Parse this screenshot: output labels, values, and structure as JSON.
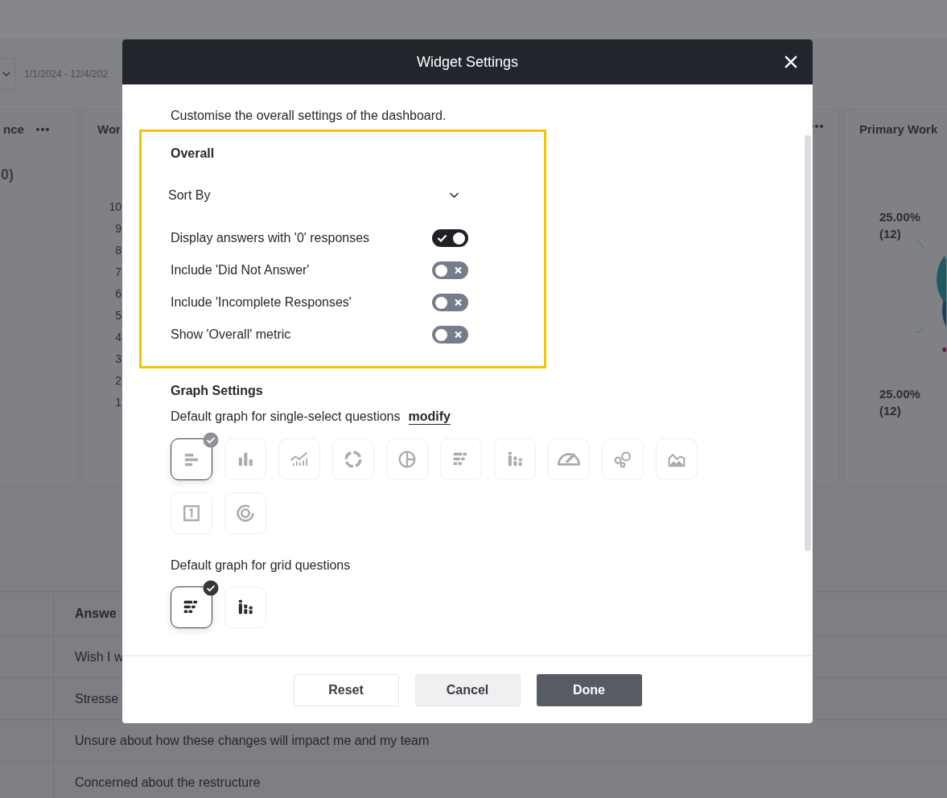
{
  "background": {
    "date_range": "1/1/2024 - 12/4/202",
    "cards": [
      {
        "kind": "value",
        "title": "nce",
        "value": "0)",
        "menu": true
      },
      {
        "kind": "axis",
        "title": "Wor",
        "axis_labels": [
          "10",
          "9",
          "8",
          "7",
          "6",
          "5",
          "4",
          "3",
          "2",
          "1"
        ]
      },
      {
        "kind": "hidden",
        "menu": true
      },
      {
        "kind": "pie",
        "title": "Primary Work",
        "slice_labels": [
          {
            "percent": "25.00%",
            "count": "(12)"
          },
          {
            "percent": "25.00%",
            "count": "(12)"
          }
        ]
      }
    ],
    "table": {
      "header": "Answe",
      "rows": [
        "Wish I w",
        "Stresse",
        "Unsure about how these changes will impact me and my team",
        "Concerned about the restructure"
      ]
    }
  },
  "dialog": {
    "title": "Widget Settings",
    "intro": "Customise the overall settings of the dashboard.",
    "overall": {
      "highlighted": true,
      "heading": "Overall",
      "sort_by": {
        "label": "Sort By"
      },
      "toggles": [
        {
          "label": "Display answers with '0' responses",
          "on": true
        },
        {
          "label": "Include 'Did Not Answer'",
          "on": false
        },
        {
          "label": "Include 'Incomplete Responses'",
          "on": false
        },
        {
          "label": "Show 'Overall' metric",
          "on": false
        }
      ]
    },
    "graph_settings": {
      "heading": "Graph Settings",
      "groups": [
        {
          "label": "Default graph for single-select questions",
          "link": "modify",
          "disabled": true,
          "graphs": [
            {
              "kind": "hbar",
              "selected": true
            },
            {
              "kind": "column",
              "selected": false
            },
            {
              "kind": "linecolumn",
              "selected": false
            },
            {
              "kind": "donut",
              "selected": false
            },
            {
              "kind": "pie",
              "selected": false
            },
            {
              "kind": "stackedhbar",
              "selected": false
            },
            {
              "kind": "stackedcolumn",
              "selected": false
            },
            {
              "kind": "gauge",
              "selected": false
            },
            {
              "kind": "bubble",
              "selected": false
            },
            {
              "kind": "area",
              "selected": false
            },
            {
              "kind": "number",
              "selected": false
            },
            {
              "kind": "radial",
              "selected": false
            }
          ]
        },
        {
          "label": "Default graph for grid questions",
          "disabled": false,
          "graphs": [
            {
              "kind": "stackedhbar",
              "selected": true
            },
            {
              "kind": "stackedcolumn",
              "selected": false
            }
          ]
        }
      ]
    },
    "buttons": [
      {
        "label": "Reset",
        "kind": "outline"
      },
      {
        "label": "Cancel",
        "kind": "secondary"
      },
      {
        "label": "Done",
        "kind": "primary"
      }
    ]
  }
}
